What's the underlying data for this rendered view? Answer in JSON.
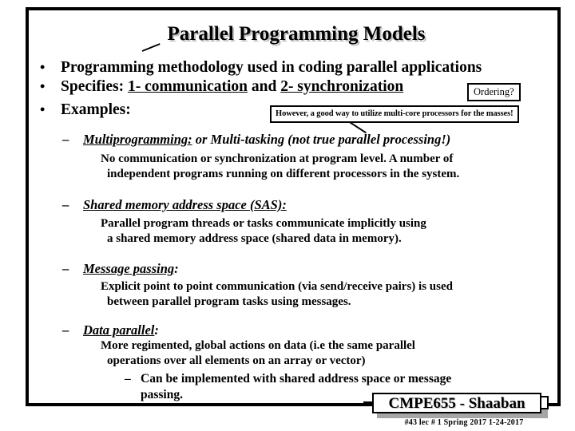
{
  "slide": {
    "title": "Parallel Programming Models",
    "bullets": [
      {
        "marker": "•",
        "text": "Programming methodology used in coding parallel applications"
      },
      {
        "marker": "•",
        "prefix": "Specifies:  ",
        "item1": "1- communication",
        "joiner": " and  ",
        "item2": "2- synchronization"
      },
      {
        "marker": "•",
        "text": "Examples:"
      }
    ],
    "ordering_box": "Ordering?",
    "callout_box": "However, a good way to utilize multi-core processors for the masses!",
    "models": [
      {
        "marker": "–",
        "head": "Multiprogramming:",
        "tail": "  or Multi-tasking (not true parallel processing!)",
        "body_line1": "No communication or synchronization at program level.  A number of",
        "body_line2": "independent programs running on different processors in the system."
      },
      {
        "marker": "–",
        "head": "Shared memory address space (SAS): ",
        "tail": "",
        "body_line1": "Parallel program threads or tasks communicate implicitly using",
        "body_line2": "a shared memory address space (shared data in memory)."
      },
      {
        "marker": "–",
        "head": "Message passing",
        "tail": ":",
        "body_line1": "Explicit point to point communication (via send/receive pairs) is used",
        "body_line2": "between parallel program tasks using messages."
      },
      {
        "marker": "–",
        "head": "Data parallel",
        "tail": ": ",
        "body_line1": "More regimented, global actions on data (i.e the same parallel",
        "body_line2": "operations over all elements on an array or vector)",
        "sub": {
          "marker": "–",
          "line1": "Can be implemented with shared address space or message",
          "line2": "passing."
        }
      }
    ],
    "footer": {
      "plate": "CMPE655 - Shaaban",
      "sub": "#43   lec # 1   Spring 2017   1-24-2017"
    }
  }
}
